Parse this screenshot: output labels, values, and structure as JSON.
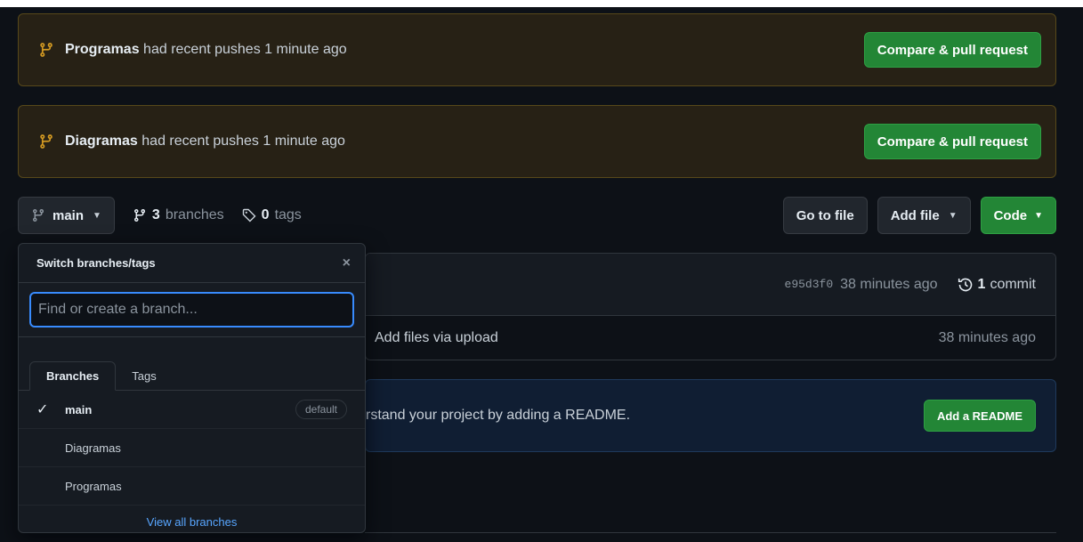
{
  "banners": [
    {
      "branch": "Programas",
      "message": "had recent pushes 1 minute ago",
      "button": "Compare & pull request"
    },
    {
      "branch": "Diagramas",
      "message": "had recent pushes 1 minute ago",
      "button": "Compare & pull request"
    }
  ],
  "toolbar": {
    "branch_button": "main",
    "branches_count": "3",
    "branches_label": "branches",
    "tags_count": "0",
    "tags_label": "tags",
    "go_to_file": "Go to file",
    "add_file": "Add file",
    "code": "Code"
  },
  "commit": {
    "sha": "e95d3f0",
    "time": "38 minutes ago",
    "count": "1",
    "count_label": "commit",
    "file_message": "Add files via upload",
    "file_time": "38 minutes ago"
  },
  "readme": {
    "text": "rstand your project by adding a README.",
    "button": "Add a README"
  },
  "dropdown": {
    "title": "Switch branches/tags",
    "close": "×",
    "placeholder": "Find or create a branch...",
    "tabs": [
      "Branches",
      "Tags"
    ],
    "branches": [
      {
        "name": "main",
        "badge": "default",
        "selected": true
      },
      {
        "name": "Diagramas"
      },
      {
        "name": "Programas"
      }
    ],
    "footer": "View all branches"
  },
  "colors": {
    "background": "#0d1117",
    "banner_bg": "#272115",
    "banner_icon": "#d29922",
    "green": "#238636",
    "link": "#58a6ff",
    "focus": "#388bfd"
  },
  "icons": {
    "banner": "git-branch-icon",
    "toolbar_branch": "git-branch-icon",
    "tag": "tag-icon",
    "history": "history-icon",
    "check": "check-icon",
    "close": "close-icon"
  }
}
